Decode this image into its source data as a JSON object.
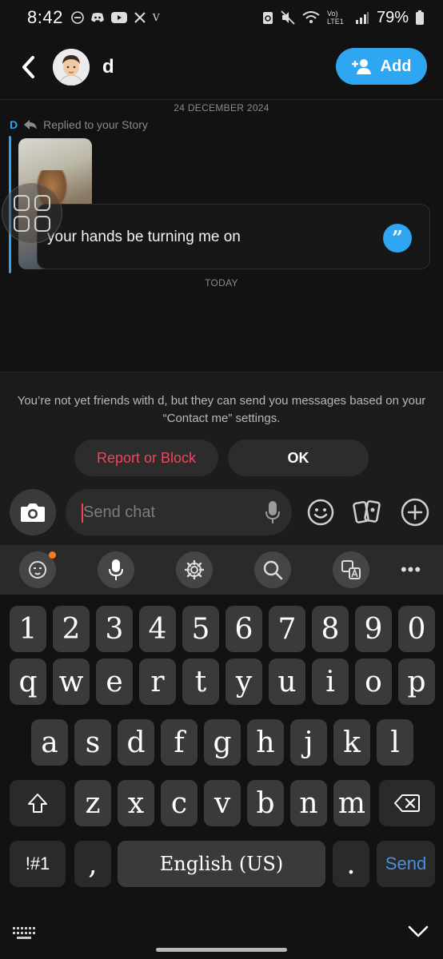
{
  "status_bar": {
    "time": "8:42",
    "carrier_mark": "V",
    "network_label": "Vo) LTE1",
    "battery": "79%"
  },
  "header": {
    "contact_name": "d",
    "add_label": "Add"
  },
  "chat": {
    "date_label": "24 DECEMBER 2024",
    "reply_sender": "D",
    "reply_context": "Replied to your Story",
    "message_text": "your hands be turning me on",
    "today_label": "TODAY"
  },
  "notice": {
    "text": "You’re not yet friends with d, but they can send you messages based on your “Contact me” settings.",
    "report_label": "Report or Block",
    "ok_label": "OK"
  },
  "composer": {
    "placeholder": "Send chat"
  },
  "keyboard": {
    "number_row": [
      "1",
      "2",
      "3",
      "4",
      "5",
      "6",
      "7",
      "8",
      "9",
      "0"
    ],
    "row1": [
      "q",
      "w",
      "e",
      "r",
      "t",
      "y",
      "u",
      "i",
      "o",
      "p"
    ],
    "row2": [
      "a",
      "s",
      "d",
      "f",
      "g",
      "h",
      "j",
      "k",
      "l"
    ],
    "row3": [
      "z",
      "x",
      "c",
      "v",
      "b",
      "n",
      "m"
    ],
    "symbols_label": "!#1",
    "comma_label": ",",
    "space_label": "English (US)",
    "period_label": ".",
    "send_label": "Send",
    "send_color": "#4a90e2"
  },
  "colors": {
    "accent_blue": "#2fa6f2",
    "report_red": "#f0455a",
    "notification_dot": "#ff7a1a"
  }
}
